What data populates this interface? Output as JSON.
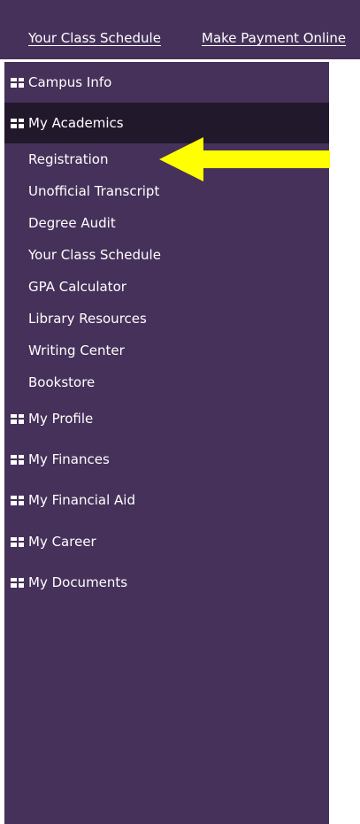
{
  "topbar": {
    "links": [
      "Your Class Schedule",
      "Make Payment Online"
    ]
  },
  "sidebar": {
    "sections": [
      {
        "label": "Campus Info",
        "active": false
      },
      {
        "label": "My Academics",
        "active": true
      },
      {
        "label": "My Profile",
        "active": false
      },
      {
        "label": "My Finances",
        "active": false
      },
      {
        "label": "My Financial Aid",
        "active": false
      },
      {
        "label": "My Career",
        "active": false
      },
      {
        "label": "My Documents",
        "active": false
      }
    ],
    "academics_items": [
      "Registration",
      "Unofficial Transcript",
      "Degree Audit",
      "Your Class Schedule",
      "GPA Calculator",
      "Library Resources",
      "Writing Center",
      "Bookstore"
    ]
  },
  "annotation": {
    "arrow_color": "#ffff00",
    "points_to": "Registration"
  },
  "colors": {
    "sidebar_bg": "#46315a",
    "active_bg": "#22182c",
    "text": "#ffffff"
  }
}
